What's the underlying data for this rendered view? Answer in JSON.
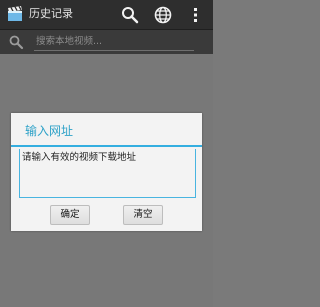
{
  "action_bar": {
    "title": "历史记录",
    "icons": {
      "app": "clapperboard-icon",
      "search": "search-icon",
      "globe": "globe-icon",
      "menu": "overflow-menu-icon"
    }
  },
  "search_row": {
    "placeholder": "搜索本地视频..."
  },
  "dialog": {
    "title": "输入网址",
    "input_placeholder": "请输入有效的视频下载地址",
    "confirm_label": "确定",
    "clear_label": "清空"
  },
  "colors": {
    "accent": "#34aee0",
    "title_accent": "#2fa2c8",
    "action_bar_bg": "#2e2e2e",
    "dim_bg": "#787878"
  }
}
